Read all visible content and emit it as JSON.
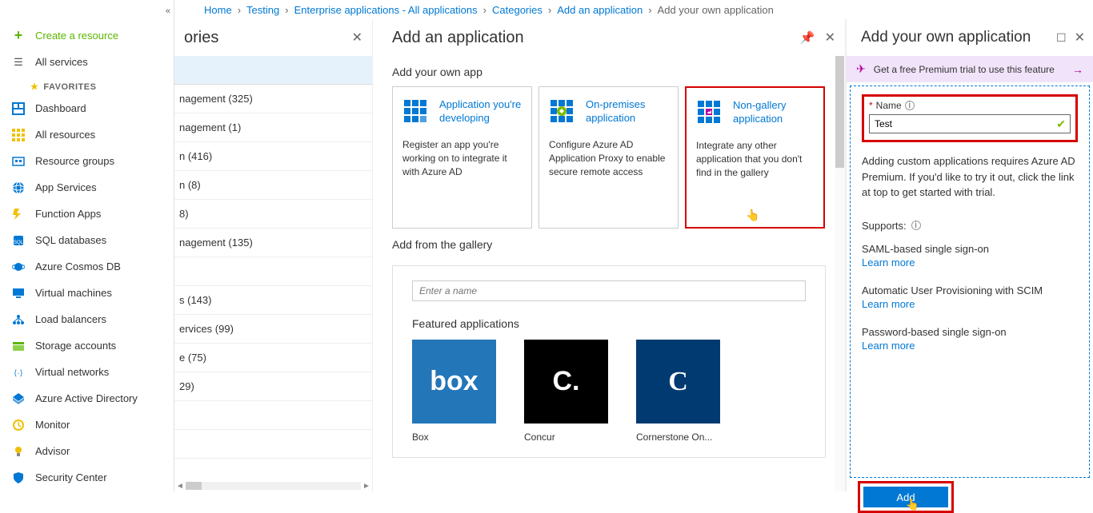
{
  "breadcrumb": {
    "items": [
      "Home",
      "Testing",
      "Enterprise applications - All applications",
      "Categories",
      "Add an application"
    ],
    "current": "Add your own application"
  },
  "sidebar": {
    "create": "Create a resource",
    "all_services": "All services",
    "fav_header": "FAVORITES",
    "items": [
      "Dashboard",
      "All resources",
      "Resource groups",
      "App Services",
      "Function Apps",
      "SQL databases",
      "Azure Cosmos DB",
      "Virtual machines",
      "Load balancers",
      "Storage accounts",
      "Virtual networks",
      "Azure Active Directory",
      "Monitor",
      "Advisor",
      "Security Center"
    ]
  },
  "categories": {
    "title": "ories",
    "rows": [
      "nagement (325)",
      "nagement (1)",
      "n (416)",
      "n (8)",
      "8)",
      "nagement (135)",
      "",
      "s (143)",
      "ervices (99)",
      "e (75)",
      "29)",
      "",
      ""
    ]
  },
  "addapp": {
    "title": "Add an application",
    "own_label": "Add your own app",
    "tiles": [
      {
        "title": "Application you're developing",
        "desc": "Register an app you're working on to integrate it with Azure AD"
      },
      {
        "title": "On-premises application",
        "desc": "Configure Azure AD Application Proxy to enable secure remote access"
      },
      {
        "title": "Non-gallery application",
        "desc": "Integrate any other application that you don't find in the gallery"
      }
    ],
    "gallery_label": "Add from the gallery",
    "search_placeholder": "Enter a name",
    "featured_label": "Featured applications",
    "apps": [
      {
        "name": "Box",
        "bg": "#2376b8",
        "glyph": "box"
      },
      {
        "name": "Concur",
        "bg": "#000000",
        "glyph": "C."
      },
      {
        "name": "Cornerstone On...",
        "bg": "#003a70",
        "glyph": "C"
      }
    ]
  },
  "own": {
    "title": "Add your own application",
    "promo": "Get a free Premium trial to use this feature",
    "name_label": "Name",
    "name_value": "Test",
    "help": "Adding custom applications requires Azure AD Premium. If you'd like to try it out, click the link at top to get started with trial.",
    "supports_label": "Supports:",
    "supports": [
      {
        "text": "SAML-based single sign-on",
        "link": "Learn more"
      },
      {
        "text": "Automatic User Provisioning with SCIM",
        "link": "Learn more"
      },
      {
        "text": "Password-based single sign-on",
        "link": "Learn more"
      }
    ],
    "add_button": "Add"
  }
}
